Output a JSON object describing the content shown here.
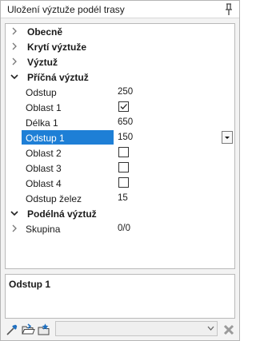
{
  "window": {
    "title": "Uložení výztuže podél trasy"
  },
  "tree": {
    "cat_obecne": "Obecně",
    "cat_kryti": "Krytí výztuže",
    "cat_vyztuz": "Výztuž",
    "cat_pricna": "Příčná výztuž",
    "odstup_label": "Odstup",
    "odstup_value": "250",
    "oblast1_label": "Oblast 1",
    "oblast1_checked": true,
    "delka1_label": "Délka 1",
    "delka1_value": "650",
    "odstup1_label": "Odstup 1",
    "odstup1_value": "150",
    "oblast2_label": "Oblast 2",
    "oblast2_checked": false,
    "oblast3_label": "Oblast 3",
    "oblast3_checked": false,
    "oblast4_label": "Oblast 4",
    "oblast4_checked": false,
    "odstup_zelez_label": "Odstup želez",
    "odstup_zelez_value": "15",
    "cat_podelna": "Podélná výztuž",
    "skupina_label": "Skupina",
    "skupina_value": "0/0"
  },
  "description": {
    "title": "Odstup 1"
  },
  "toolbar": {
    "combo_value": ""
  },
  "colors": {
    "selection": "#1e7fd6",
    "border": "#b9b9b9"
  }
}
